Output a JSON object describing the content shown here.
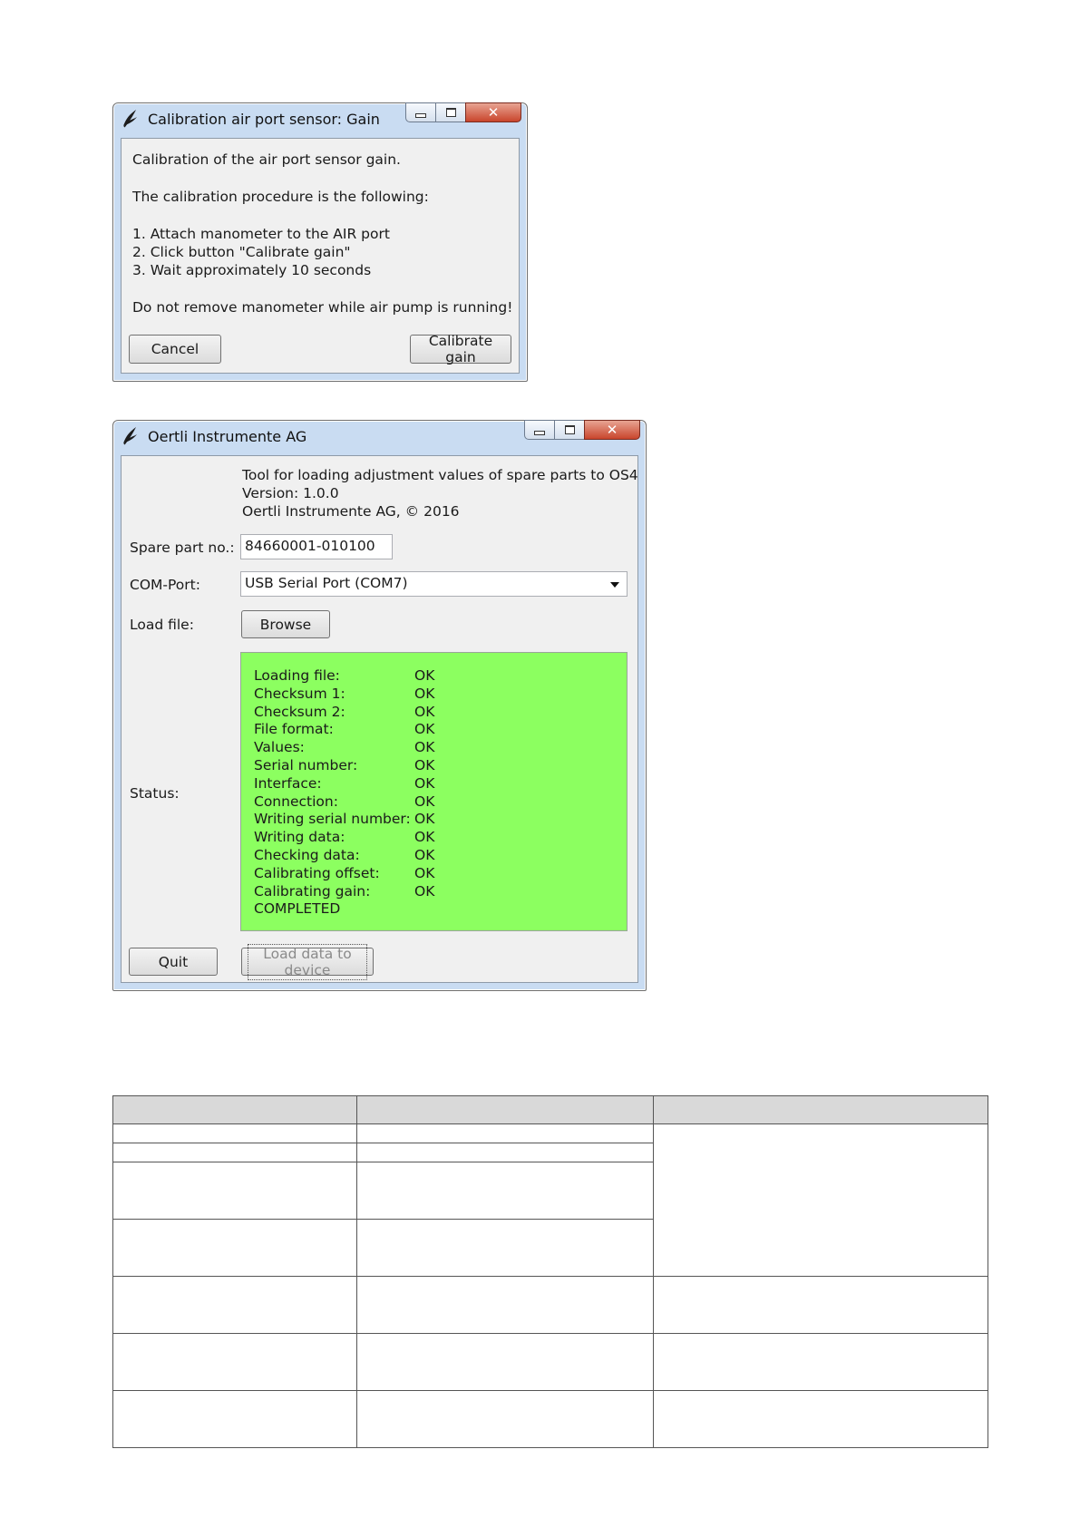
{
  "dialog1": {
    "title": "Calibration air port sensor: Gain",
    "lines": [
      "Calibration of the air port sensor gain.",
      "The calibration procedure is the following:",
      "1. Attach manometer to the AIR port",
      "2. Click button \"Calibrate gain\"",
      "3. Wait approximately 10 seconds",
      "Do not remove manometer while air pump is running!"
    ],
    "cancel_label": "Cancel",
    "calibrate_label": "Calibrate gain"
  },
  "dialog2": {
    "title": "Oertli Instrumente AG",
    "header_lines": [
      "Tool for loading adjustment values of spare parts to OS4",
      "Version: 1.0.0",
      "Oertli Instrumente AG, © 2016"
    ],
    "spare_part_label": "Spare part no.:",
    "spare_part_value": "84660001-010100",
    "com_port_label": "COM-Port:",
    "com_port_value": "USB Serial Port (COM7)",
    "load_file_label": "Load file:",
    "browse_label": "Browse",
    "status_label": "Status:",
    "status_rows": [
      {
        "label": "Loading file:",
        "value": "OK"
      },
      {
        "label": "Checksum 1:",
        "value": "OK"
      },
      {
        "label": "Checksum 2:",
        "value": "OK"
      },
      {
        "label": "File format:",
        "value": "OK"
      },
      {
        "label": "Values:",
        "value": "OK"
      },
      {
        "label": "Serial number:",
        "value": "OK"
      },
      {
        "label": "Interface:",
        "value": "OK"
      },
      {
        "label": "Connection:",
        "value": "OK"
      },
      {
        "label": "Writing serial number:",
        "value": "OK"
      },
      {
        "label": "Writing data:",
        "value": "OK"
      },
      {
        "label": "Checking data:",
        "value": "OK"
      },
      {
        "label": "Calibrating offset:",
        "value": "OK"
      },
      {
        "label": "Calibrating gain:",
        "value": "OK"
      }
    ],
    "status_final": "COMPLETED",
    "status_color": "#8cff60",
    "quit_label": "Quit",
    "load_label": "Load data to device"
  }
}
